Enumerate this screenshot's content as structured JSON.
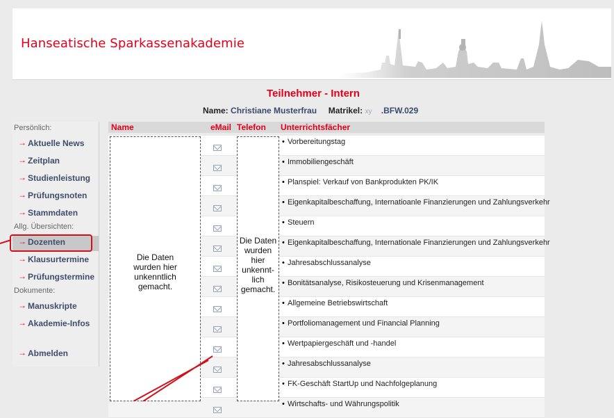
{
  "header": {
    "brand": "Hanseatische Sparkassenakademie",
    "page_title": "Teilnehmer - Intern",
    "name_label": "Name:",
    "name_value": "Christiane Musterfrau",
    "matrikel_label": "Matrikel:",
    "matrikel_mask": "xy",
    "matrikel_value": ".BFW.029"
  },
  "sidebar": {
    "sections": {
      "personal": "Persönlich:",
      "overviews": "Allg. Übersichten:",
      "documents": "Dokumente:"
    },
    "items": [
      {
        "label": "Aktuelle News"
      },
      {
        "label": "Zeitplan"
      },
      {
        "label": "Studienleistung"
      },
      {
        "label": "Prüfungsnoten"
      },
      {
        "label": "Stammdaten"
      },
      {
        "label": "Dozenten"
      },
      {
        "label": "Klausurtermine"
      },
      {
        "label": "Prüfungstermine"
      },
      {
        "label": "Manuskripte"
      },
      {
        "label": "Akademie-Infos"
      },
      {
        "label": "Abmelden"
      }
    ],
    "active": "Dozenten"
  },
  "table": {
    "columns": [
      "Name",
      "eMail",
      "Telefon",
      "Unterrichtsfächer"
    ],
    "name_mask_text": "Die Daten wurden hier unkenntlich gemacht.",
    "phone_mask_text": "Die Daten wurden hier unkennt- lich gemacht.",
    "subjects": [
      "Vorbereitungstag",
      "Immobiliengeschäft",
      "Planspiel: Verkauf von Bankprodukten PK/IK",
      "Eigenkapitalbeschaffung, Internatioanle Finanzierungen und Zahlungsverkehr",
      "Steuern",
      "Eigenkapitalbeschaffung, Internationale Finanzierungen und Zahlungsverkehr",
      "Jahresabschlussanalyse",
      "Bonitätsanalyse, Risikosteuerung und Krisenmanagement",
      "Allgemeine Betriebswirtschaft",
      "Portfoliomanagement und Financial Planning",
      "Wertpapiergeschäft und -handel",
      "Jahresabschlussanalyse",
      "FK-Geschäft StartUp und Nachfolgeplanung",
      "Wirtschafts- und Währungspolitik"
    ]
  },
  "colors": {
    "accent": "#e2001a",
    "nav_text": "#3f4d6b",
    "background": "#ebebeb"
  }
}
